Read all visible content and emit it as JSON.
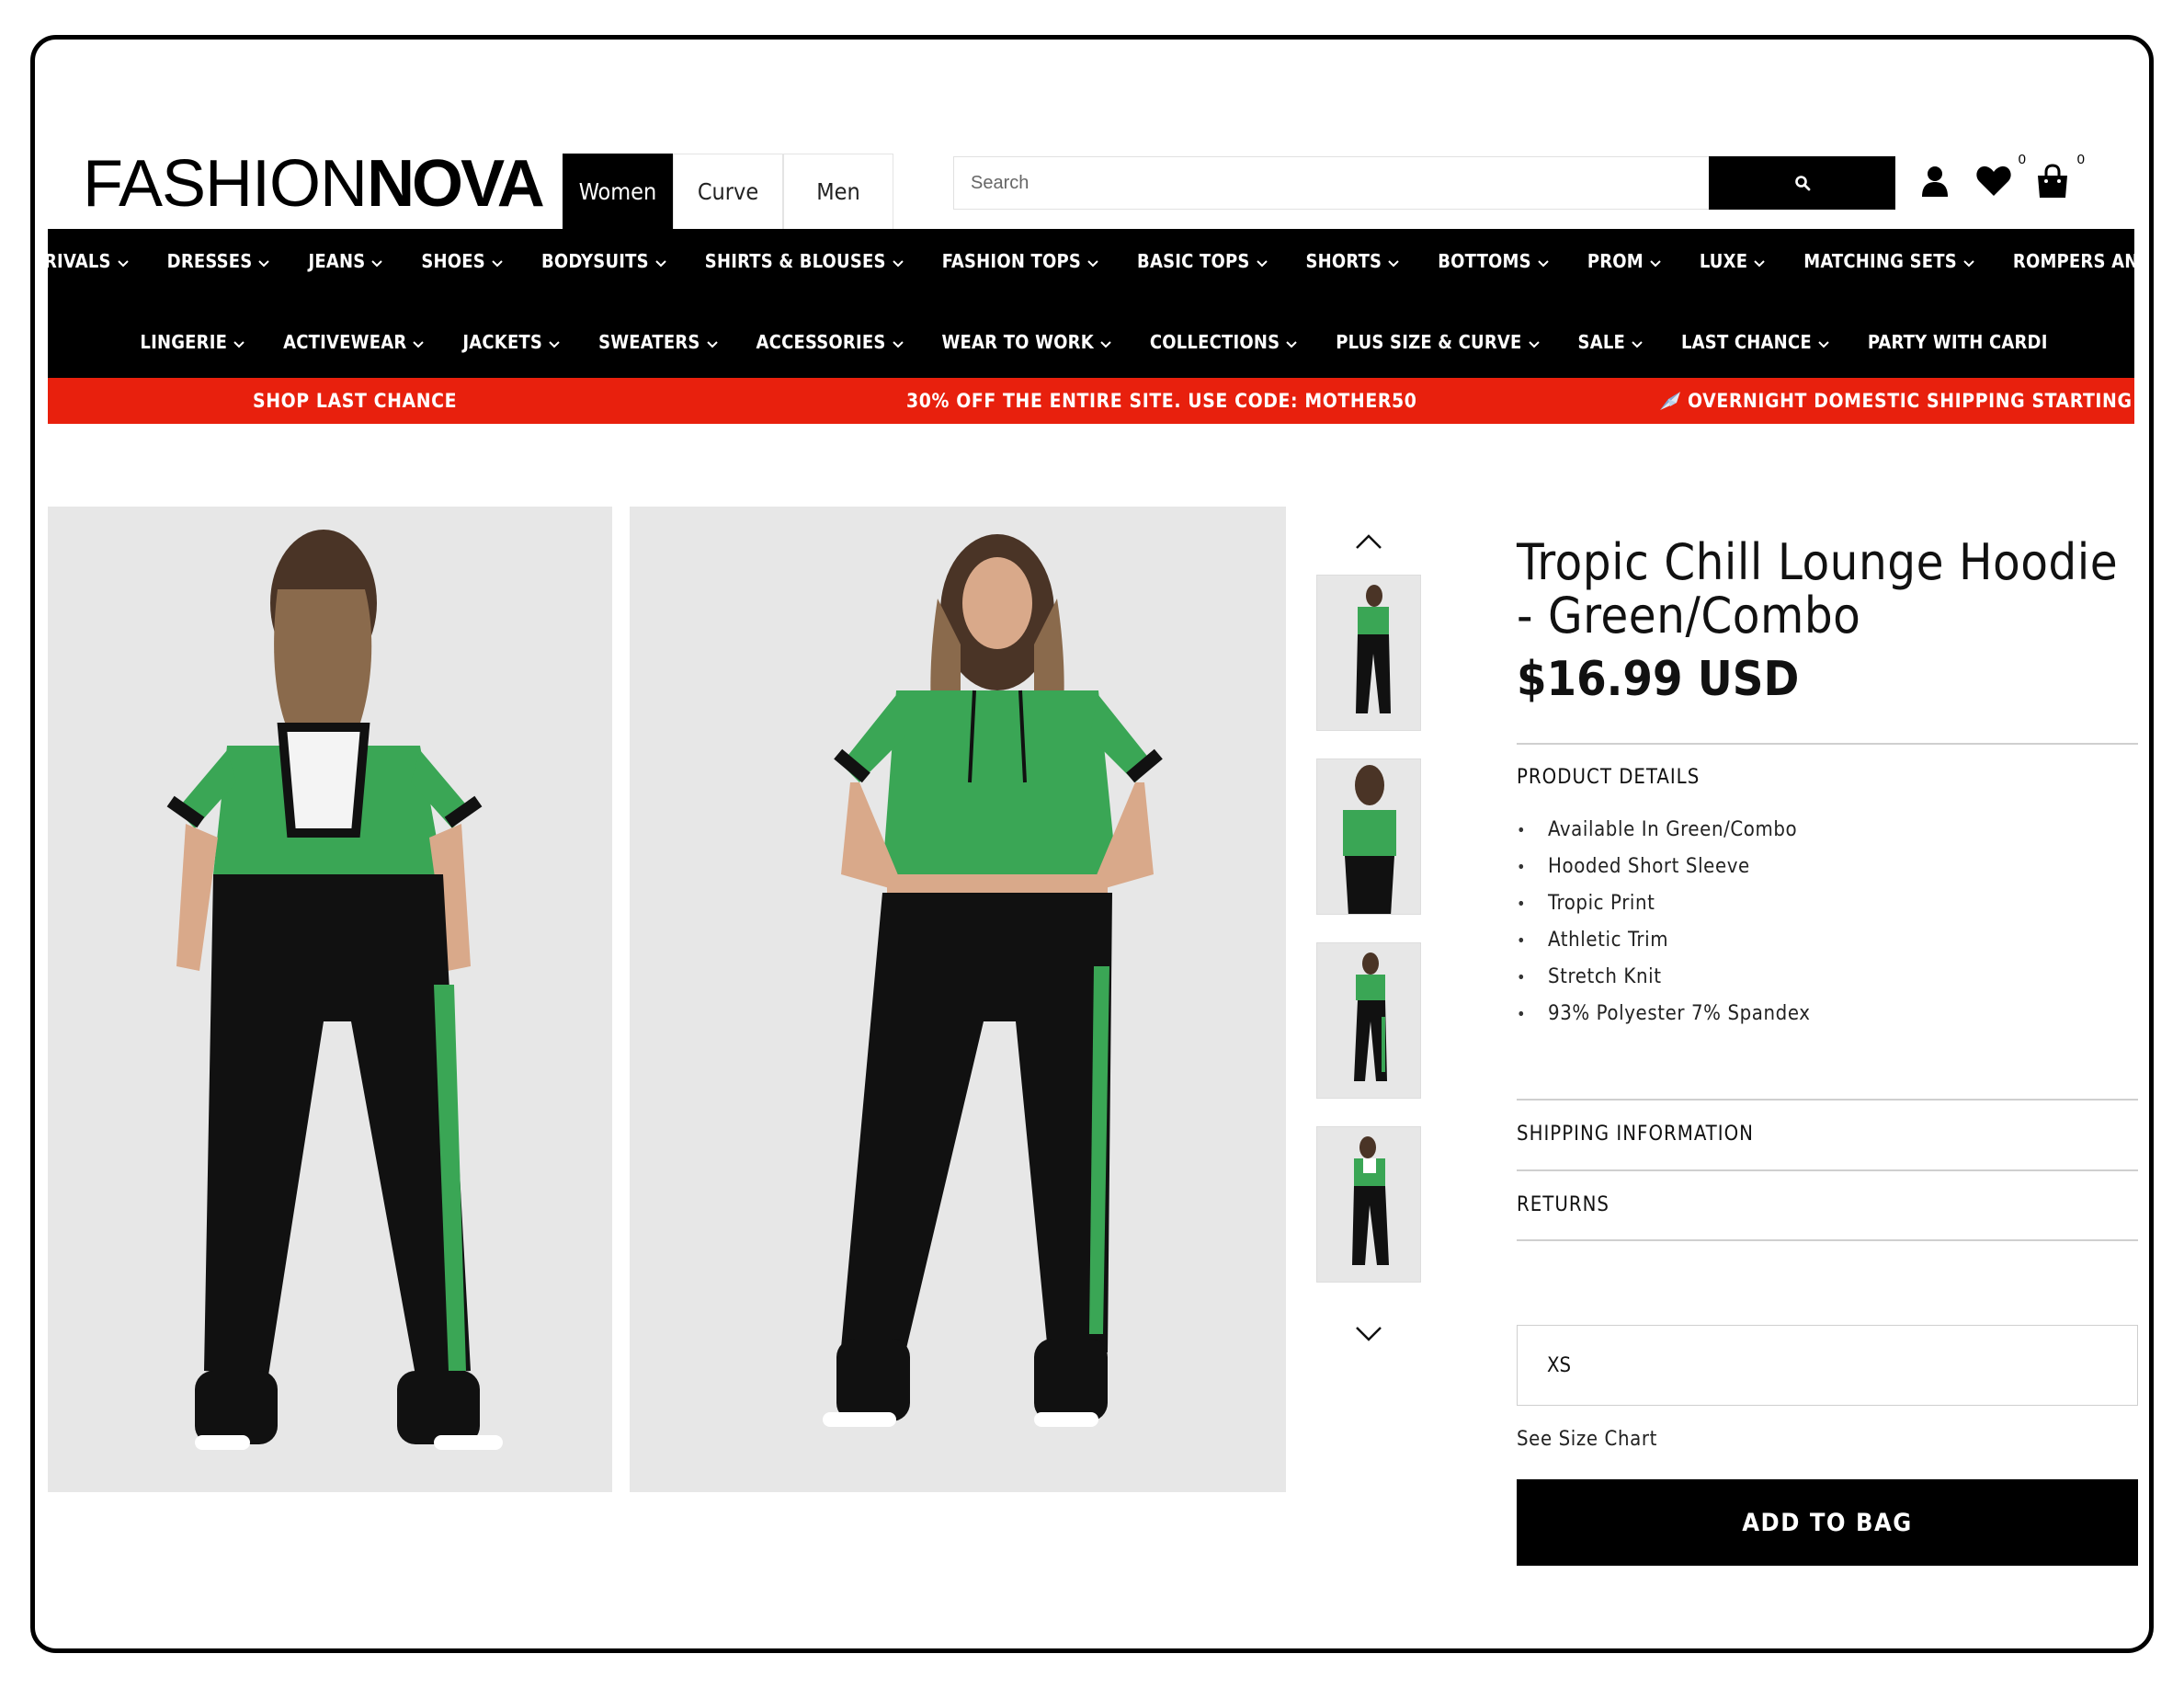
{
  "brand": {
    "logo_light": "FASHION",
    "logo_bold": "NOVA"
  },
  "gender_tabs": [
    {
      "label": "Women",
      "active": true
    },
    {
      "label": "Curve",
      "active": false
    },
    {
      "label": "Men",
      "active": false
    }
  ],
  "search": {
    "placeholder": "Search",
    "button_icon": "search-icon"
  },
  "header_icons": {
    "account_icon": "user-icon",
    "wishlist_icon": "heart-icon",
    "wishlist_count": "0",
    "bag_icon": "shopping-bag-icon",
    "bag_count": "0"
  },
  "nav": {
    "row1": [
      "RIVALS",
      "DRESSES",
      "JEANS",
      "SHOES",
      "BODYSUITS",
      "SHIRTS & BLOUSES",
      "FASHION TOPS",
      "BASIC TOPS",
      "SHORTS",
      "BOTTOMS",
      "PROM",
      "LUXE",
      "MATCHING SETS",
      "ROMPERS AND JUMPSUITS"
    ],
    "row2": [
      "LINGERIE",
      "ACTIVEWEAR",
      "JACKETS",
      "SWEATERS",
      "ACCESSORIES",
      "WEAR TO WORK",
      "COLLECTIONS",
      "PLUS SIZE & CURVE",
      "SALE",
      "LAST CHANCE",
      "PARTY WITH CARDI"
    ]
  },
  "promo": {
    "left": "SHOP LAST CHANCE",
    "center": "30% OFF THE ENTIRE SITE. USE CODE: MOTHER50",
    "right": "OVERNIGHT DOMESTIC SHIPPING STARTING AT",
    "right_icon": "airplane-icon",
    "color": "#e8200d"
  },
  "product": {
    "title": "Tropic Chill Lounge Hoodie - Green/Combo",
    "price": "$16.99 USD",
    "details_heading": "PRODUCT DETAILS",
    "details": [
      "Available In Green/Combo",
      "Hooded Short Sleeve",
      "Tropic Print",
      "Athletic Trim",
      "Stretch Knit",
      "93% Polyester 7% Spandex"
    ],
    "shipping_heading": "SHIPPING INFORMATION",
    "returns_heading": "RETURNS",
    "size_selected": "XS",
    "size_chart_link": "See Size Chart",
    "add_to_bag": "ADD TO BAG",
    "print_color": "#3aa655",
    "pants_color": "#111111"
  },
  "gallery": {
    "photo_views": [
      "back",
      "front"
    ],
    "thumbnails": [
      "front-full",
      "front-crop",
      "side",
      "back"
    ],
    "arrow_up_icon": "chevron-up-icon",
    "arrow_down_icon": "chevron-down-icon"
  }
}
